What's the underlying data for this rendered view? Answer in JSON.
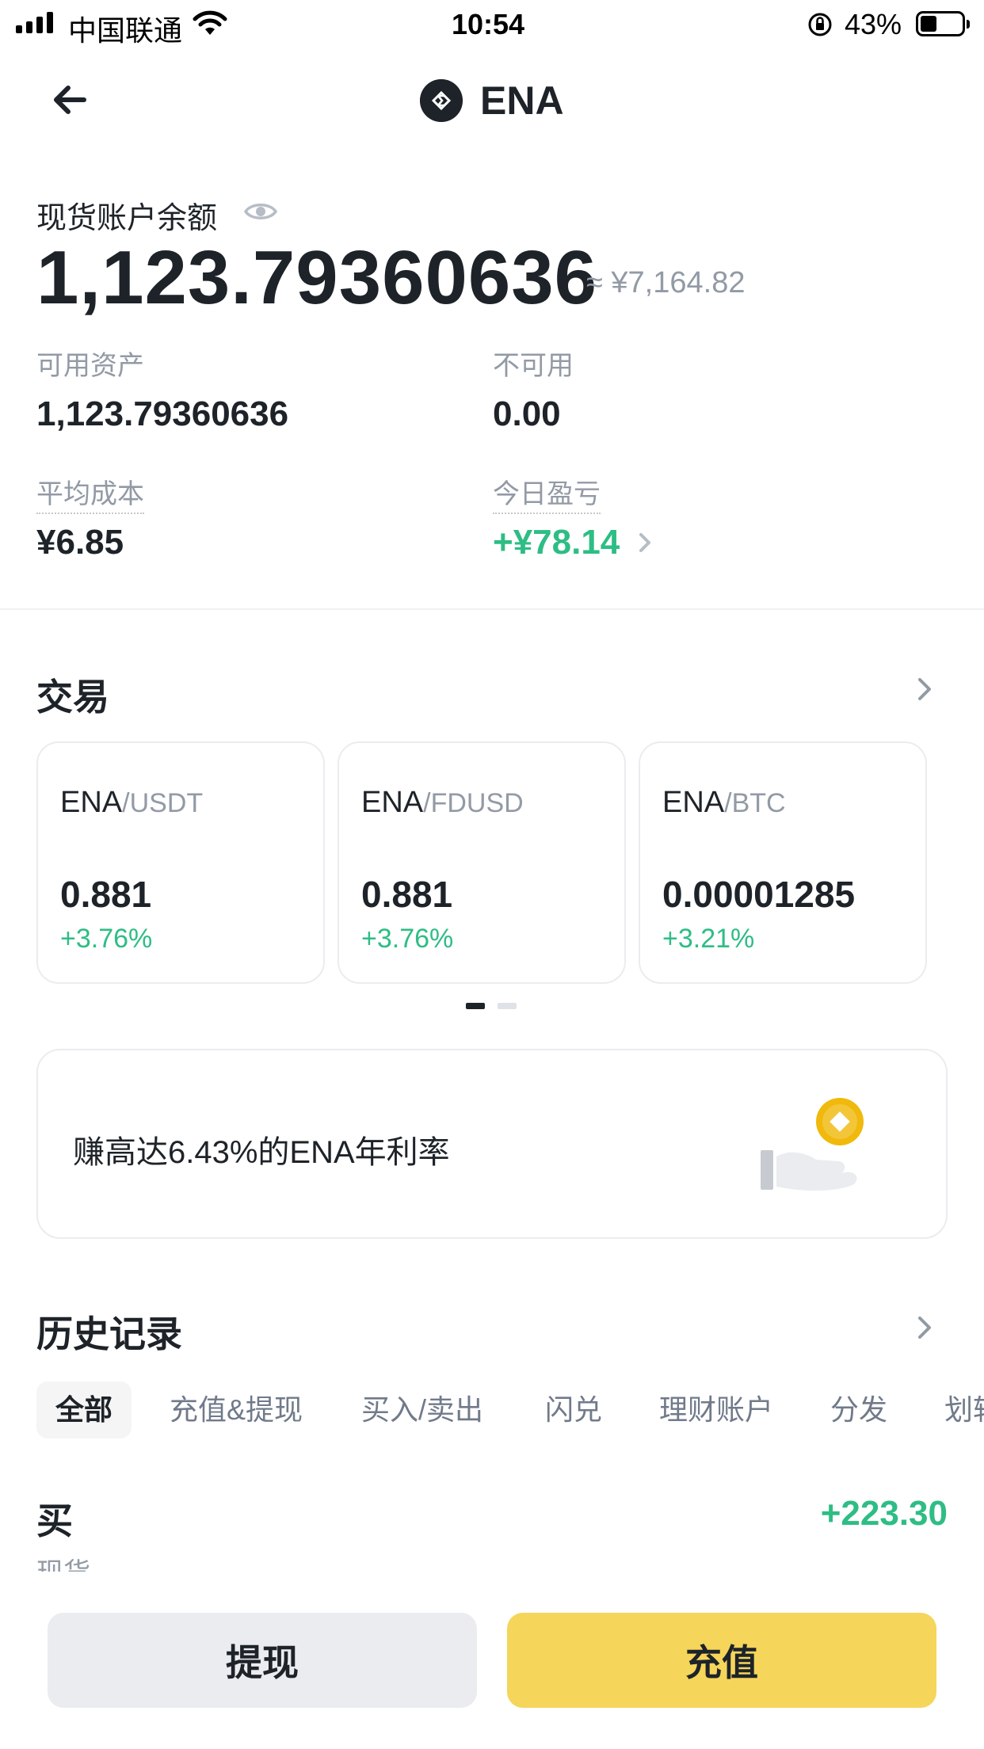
{
  "status_bar": {
    "carrier": "中国联通",
    "time": "10:54",
    "battery": "43%"
  },
  "header": {
    "title": "ENA",
    "back_icon": "back-arrow-icon",
    "logo_icon": "ena-logo-icon"
  },
  "balance": {
    "label": "现货账户余额",
    "eye_icon": "eye-icon",
    "amount": "1,123.79360636",
    "fiat": "≈ ¥7,164.82",
    "available_label": "可用资产",
    "available_value": "1,123.79360636",
    "unavailable_label": "不可用",
    "unavailable_value": "0.00",
    "avg_cost_label": "平均成本",
    "avg_cost_value": "¥6.85",
    "pnl_label": "今日盈亏",
    "pnl_value": "+¥78.14"
  },
  "trade": {
    "title": "交易",
    "pairs": [
      {
        "base": "ENA",
        "quote": "/USDT",
        "price": "0.881",
        "change": "+3.76%"
      },
      {
        "base": "ENA",
        "quote": "/FDUSD",
        "price": "0.881",
        "change": "+3.76%"
      },
      {
        "base": "ENA",
        "quote": "/BTC",
        "price": "0.00001285",
        "change": "+3.21%"
      }
    ],
    "pager_pages": 2,
    "pager_current": 1
  },
  "earn": {
    "text": "赚高达6.43%的ENA年利率",
    "illustration": "coin-hand-icon"
  },
  "history": {
    "title": "历史记录",
    "tabs": [
      "全部",
      "充值&提现",
      "买入/卖出",
      "闪兑",
      "理财账户",
      "分发",
      "划转"
    ],
    "active_tab": 0,
    "entries": [
      {
        "type": "买",
        "sub": "现货",
        "amount": "+223.30"
      }
    ]
  },
  "actions": {
    "withdraw": "提现",
    "deposit": "充值"
  },
  "colors": {
    "green": "#2ebd85",
    "yellow": "#f5d55a",
    "text": "#1e2329",
    "muted": "#929aa5"
  }
}
